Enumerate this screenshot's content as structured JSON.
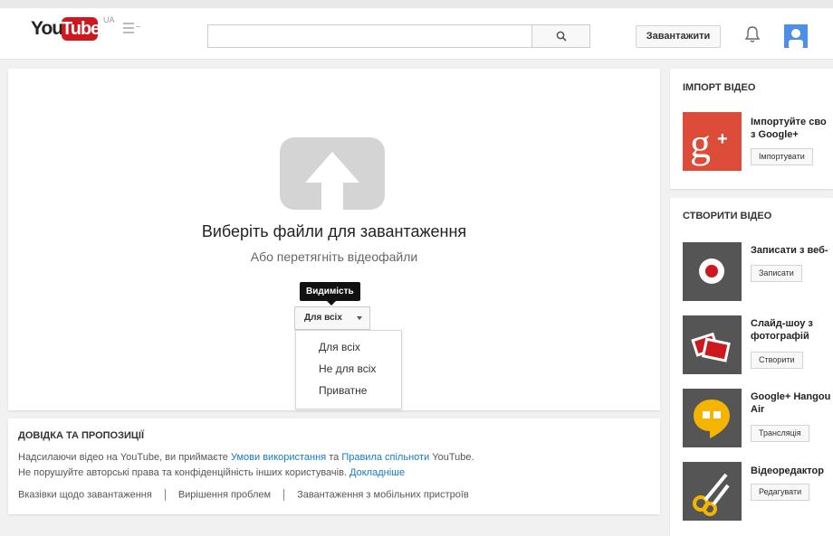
{
  "header": {
    "logo_you": "You",
    "logo_tube": "Tube",
    "logo_region": "UA",
    "search_placeholder": "",
    "upload_button": "Завантажити"
  },
  "upload": {
    "title": "Виберіть файли для завантаження",
    "subtitle": "Або перетягніть відеофайли",
    "tooltip": "Видимість",
    "privacy_selected": "Для всіх",
    "privacy_options": [
      "Для всіх",
      "Не для всіх",
      "Приватне"
    ]
  },
  "help": {
    "title": "ДОВІДКА ТА ПРОПОЗИЦІЇ",
    "line1_prefix": "Надсилаючи відео на YouTube, ви приймаєте ",
    "terms_link": "Умови використання",
    "line1_mid": " та ",
    "community_link": "Правила спільноти",
    "line1_suffix": " YouTube.",
    "line2_text": "Не порушуйте авторські права та конфіденційність інших користувачів. ",
    "learn_more_link": "Докладніше",
    "links": [
      "Вказівки щодо завантаження",
      "Вирішення проблем",
      "Завантаження з мобільних пристроїв"
    ]
  },
  "sidebar": {
    "import_title": "ІМПОРТ ВІДЕО",
    "import_item": {
      "label_line1": "Імпортуйте сво",
      "label_line2": "з Google+",
      "button": "Імпортувати"
    },
    "create_title": "СТВОРИТИ ВІДЕО",
    "create_items": [
      {
        "label_line1": "Записати з веб-",
        "label_line2": "",
        "button": "Записати"
      },
      {
        "label_line1": "Слайд-шоу з",
        "label_line2": "фотографій",
        "button": "Створити"
      },
      {
        "label_line1": "Google+ Hangou",
        "label_line2": "Air",
        "button": "Трансляція"
      },
      {
        "label_line1": "Відеоредактор",
        "label_line2": "",
        "button": "Редагувати"
      }
    ]
  },
  "colors": {
    "brand_red": "#cc181e",
    "link_blue": "#167ac6",
    "google_plus_red": "#dd4b39",
    "hangouts_yellow": "#f4b400",
    "tile_dark": "#555555"
  }
}
